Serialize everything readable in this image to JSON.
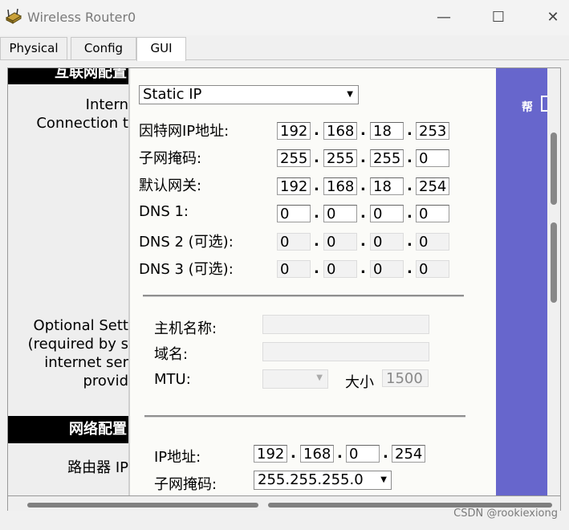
{
  "window": {
    "title": "Wireless Router0",
    "minimize": "—",
    "maximize": "☐",
    "close": "✕"
  },
  "tabs": [
    "Physical",
    "Config",
    "GUI"
  ],
  "left": {
    "section1_header": "互联网配置",
    "internet_label_1": "Intern",
    "internet_label_2": "Connection t",
    "optional_1": "Optional Sett",
    "optional_2": "(required by s",
    "optional_3": "internet ser",
    "optional_4": "provid",
    "section2_header": "网络配置",
    "router_ip": "路由器 IP"
  },
  "internet": {
    "connection_type": "Static IP",
    "ip_label": "因特网IP地址:",
    "ip": [
      "192",
      "168",
      "18",
      "253"
    ],
    "mask_label": "子网掩码:",
    "mask": [
      "255",
      "255",
      "255",
      "0"
    ],
    "gateway_label": "默认网关:",
    "gateway": [
      "192",
      "168",
      "18",
      "254"
    ],
    "dns1_label": "DNS 1:",
    "dns1": [
      "0",
      "0",
      "0",
      "0"
    ],
    "dns2_label": "DNS 2 (可选):",
    "dns2": [
      "0",
      "0",
      "0",
      "0"
    ],
    "dns3_label": "DNS 3 (可选):",
    "dns3": [
      "0",
      "0",
      "0",
      "0"
    ]
  },
  "optional": {
    "host_label": "主机名称:",
    "host_value": "",
    "domain_label": "域名:",
    "domain_value": "",
    "mtu_label": "MTU:",
    "mtu_value": "",
    "size_label": "大小",
    "size_value": "1500"
  },
  "network": {
    "ip_label": "IP地址:",
    "ip": [
      "192",
      "168",
      "0",
      "254"
    ],
    "mask_label": "子网掩码:",
    "mask": "255.255.255.0"
  },
  "right_panel": {
    "help": "帮"
  },
  "watermark": "CSDN @rookiexiong",
  "colors": {
    "right_panel": "#6766cc",
    "header_bg": "#000000"
  }
}
